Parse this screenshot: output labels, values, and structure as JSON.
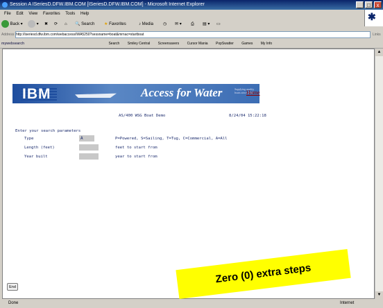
{
  "window": {
    "title": "Session A ISeriesD.DFW.IBM.COM [ISeriesD.DFW.IBM.COM] - Microsoft Internet Explorer"
  },
  "menu": [
    "File",
    "Edit",
    "View",
    "Favorites",
    "Tools",
    "Help"
  ],
  "toolbar": {
    "back": "Back",
    "search": "Search",
    "favorites": "Favorites",
    "media": "Media"
  },
  "address": {
    "label": "Address",
    "url": "http://iseriesd.dfw.ibm.com/webaccess/iWA5250?sessname=boat&mrnac=startboat",
    "links": "Links"
  },
  "linksbar": [
    "Search",
    "Smiley Central",
    "Screensavers",
    "Cursor Mania",
    "PopSwatter",
    "Games",
    "My Info"
  ],
  "linksbar_brand": "mywebsearch",
  "page": {
    "logo": "IBM",
    "headline": "Access for Water",
    "tagline": "Supplying quality boats since 2002",
    "home_link": "Home",
    "heading": "AS/400 WSG Boat Demo",
    "datetime": "8/24/04 15:22:18",
    "prompt": "Enter your search parameters",
    "type_label": "Type",
    "type_value": "A",
    "type_help": "P=Powered, S=Sailing, T=Tug, C=Commercial, A=All",
    "length_label": "Length (feet)",
    "length_help": "feet to start from",
    "year_label": "Year built",
    "year_help": "year to start from",
    "end_button": "End"
  },
  "note": "Zero (0) extra steps",
  "status": {
    "left": "Done",
    "right": "Internet"
  }
}
